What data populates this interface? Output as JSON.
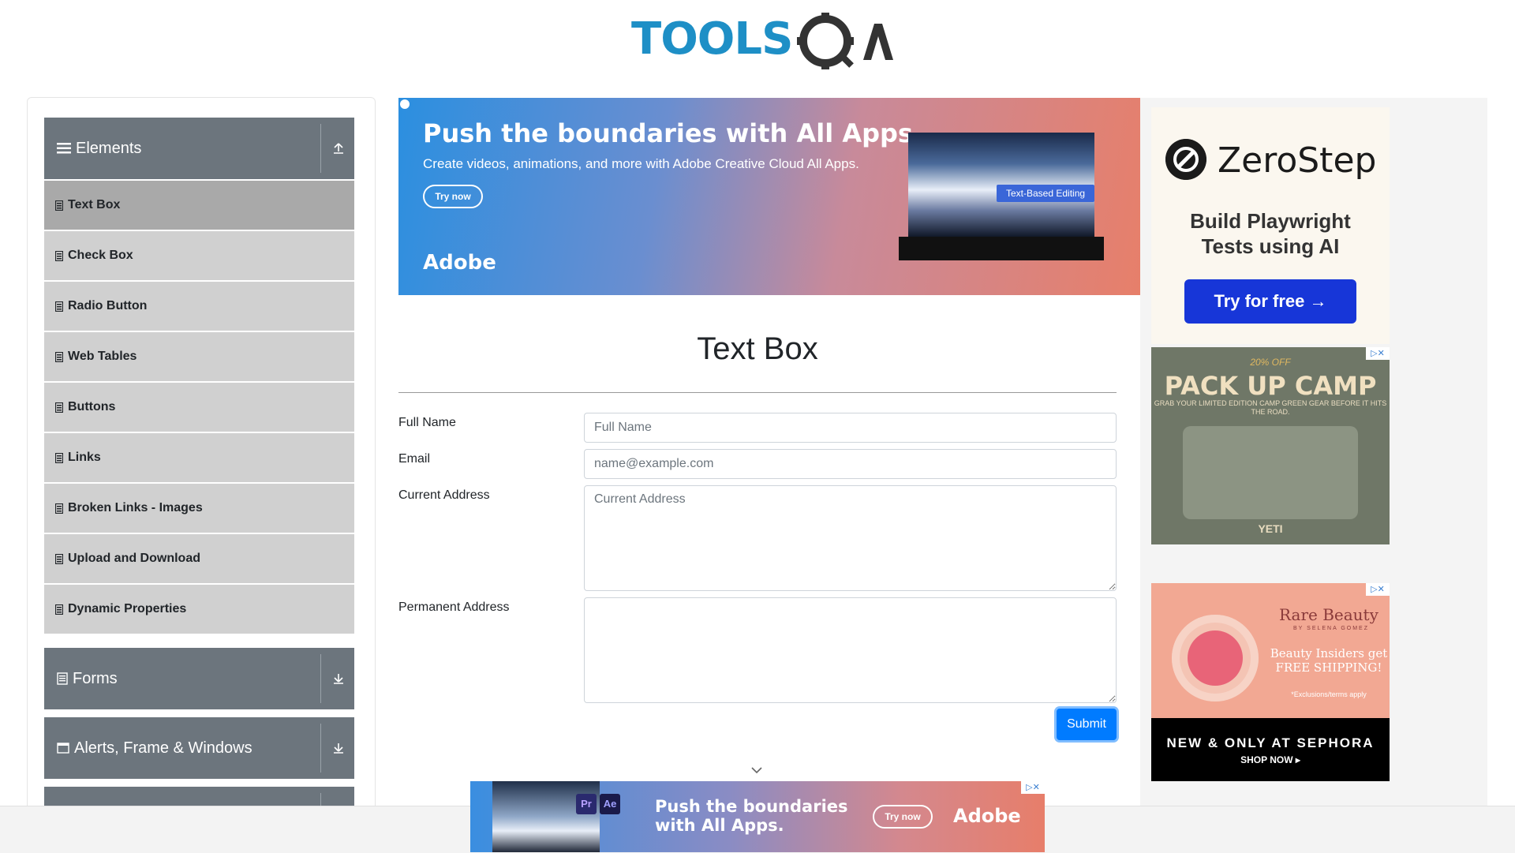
{
  "header": {
    "logo_text": "TOOLS",
    "logo_qa": "QA"
  },
  "sidebar": {
    "groups": [
      {
        "label": "Elements",
        "expanded": true
      },
      {
        "label": "Forms",
        "expanded": false
      },
      {
        "label": "Alerts, Frame & Windows",
        "expanded": false
      }
    ],
    "items": [
      {
        "label": "Text Box",
        "active": true
      },
      {
        "label": "Check Box"
      },
      {
        "label": "Radio Button"
      },
      {
        "label": "Web Tables"
      },
      {
        "label": "Buttons"
      },
      {
        "label": "Links"
      },
      {
        "label": "Broken Links - Images"
      },
      {
        "label": "Upload and Download"
      },
      {
        "label": "Dynamic Properties"
      }
    ]
  },
  "ad_top": {
    "headline": "Push the boundaries with All Apps.",
    "subline": "Create videos, animations, and more with Adobe Creative Cloud All Apps.",
    "cta": "Try now",
    "brand": "Adobe",
    "tag": "Text-Based Editing"
  },
  "form": {
    "title": "Text Box",
    "full_name_label": "Full Name",
    "full_name_placeholder": "Full Name",
    "email_label": "Email",
    "email_placeholder": "name@example.com",
    "current_address_label": "Current Address",
    "current_address_placeholder": "Current Address",
    "permanent_address_label": "Permanent Address",
    "submit_label": "Submit"
  },
  "ad_zerostep": {
    "name": "ZeroStep",
    "tagline": "Build Playwright Tests using AI",
    "cta": "Try for free →"
  },
  "ad_yeti": {
    "promo": "20% OFF",
    "headline": "PACK UP CAMP",
    "sub": "GRAB YOUR LIMITED EDITION CAMP GREEN GEAR BEFORE IT HITS THE ROAD.",
    "brand": "YETI"
  },
  "ad_sephora": {
    "brand": "Rare Beauty",
    "by": "BY SELENA GOMEZ",
    "copy": "Beauty Insiders get FREE SHIPPING!",
    "exclusions": "*Exclusions/terms apply",
    "footer_1": "NEW & ONLY AT SEPHORA",
    "footer_2": "SHOP NOW ▸"
  },
  "ad_bottom": {
    "headline": "Push the boundaries with All Apps.",
    "cta": "Try now",
    "brand": "Adobe",
    "pr": "Pr",
    "ae": "Ae"
  },
  "colors": {
    "accent": "#007bff",
    "sidebar_header": "#6c757d",
    "menu_item": "#d0d0d0",
    "menu_active": "#a9a9a9",
    "logo_blue": "#1e8fc6"
  }
}
